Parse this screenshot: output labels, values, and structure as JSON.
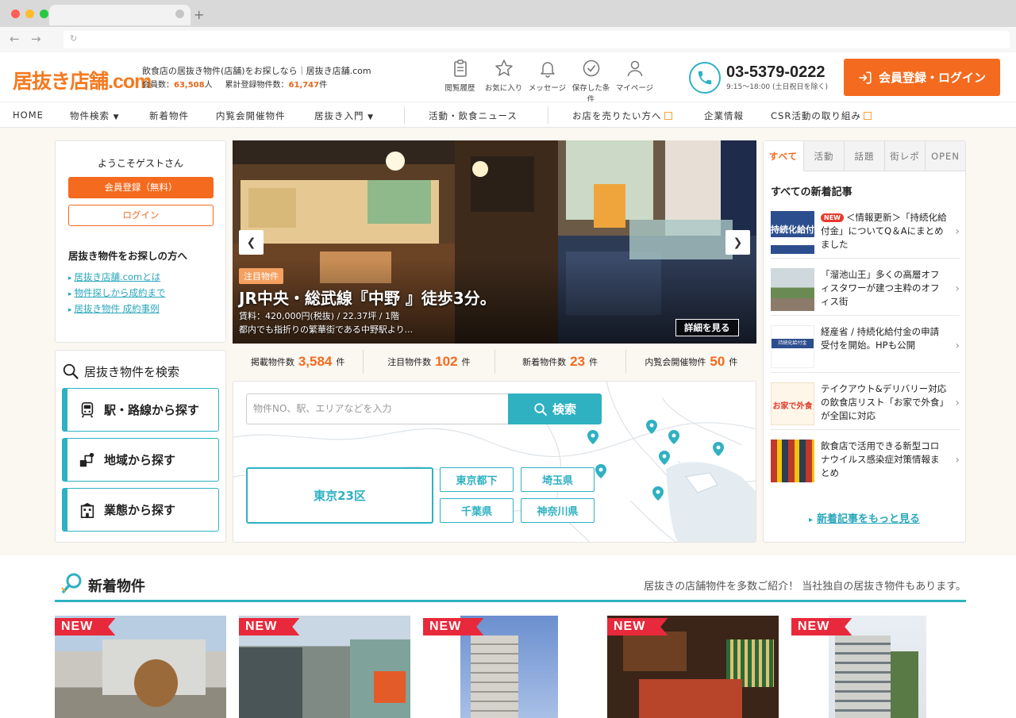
{
  "site": {
    "logo": "居抜き店舗.com",
    "tagline": "飲食店の居抜き物件(店舗)をお探しなら｜居抜き店舗.com",
    "members_label": "会員数：",
    "members_value": "63,508",
    "members_unit": "人",
    "listings_label": "累計登録物件数：",
    "listings_value": "61,747",
    "listings_unit": "件",
    "brand_color": "#f46a1e",
    "accent_color": "#2fb1c2"
  },
  "header_icons": [
    {
      "label": "閲覧履歴",
      "icon": "history-clipboard-icon"
    },
    {
      "label": "お気に入り",
      "icon": "star-icon"
    },
    {
      "label": "メッセージ",
      "icon": "bell-icon"
    },
    {
      "label": "保存した条件",
      "icon": "check-circle-icon"
    },
    {
      "label": "マイページ",
      "icon": "user-icon"
    }
  ],
  "contact": {
    "phone": "03-5379-0222",
    "hours": "9:15～18:00 (土日祝日を除く)"
  },
  "login_button": "会員登録・ログイン",
  "global_nav": {
    "home": "HOME",
    "search": "物件検索",
    "new": "新着物件",
    "viewing": "内覧会開催物件",
    "intro": "居抜き入門",
    "news": "活動・飲食ニュース",
    "sell": "お店を売りたい方へ",
    "company": "企業情報",
    "csr": "CSR活動の取り組み"
  },
  "welcome": {
    "title": "ようこそゲストさん",
    "register": "会員登録（無料）",
    "login": "ログイン",
    "subtitle": "居抜き物件をお探しの方へ",
    "links": [
      "居抜き店舗.comとは",
      "物件探しから成約まで",
      "居抜き物件 成約事例"
    ]
  },
  "search_panel": {
    "title": "居抜き物件を検索",
    "station": "駅・路線から探す",
    "area": "地域から探す",
    "business": "業態から探す"
  },
  "hero": {
    "badge": "注目物件",
    "title": "JR中央・総武線『中野 』徒歩3分。",
    "rent": "賃料：420,000円(税抜) / 22.37坪 / 1階",
    "description": "都内でも指折りの繁華街である中野駅より...",
    "detail_button": "詳細を見る"
  },
  "counts": [
    {
      "label": "掲載物件数",
      "value": "3,584",
      "unit": "件"
    },
    {
      "label": "注目物件数",
      "value": "102",
      "unit": "件"
    },
    {
      "label": "新着物件数",
      "value": "23",
      "unit": "件"
    },
    {
      "label": "内覧会開催物件",
      "value": "50",
      "unit": "件"
    }
  ],
  "map_search": {
    "placeholder": "物件NO、駅、エリアなどを入力",
    "button": "検索",
    "main_area": "東京23区",
    "areas": [
      "東京都下",
      "埼玉県",
      "千葉県",
      "神奈川県"
    ]
  },
  "news": {
    "tabs": [
      "すべて",
      "活動",
      "話題",
      "街レポ",
      "OPEN"
    ],
    "heading": "すべての新着記事",
    "items": [
      {
        "new": "NEW",
        "title": "＜情報更新＞「持続化給付金」についてQ＆Aにまとめました",
        "thumb": "持続化給付"
      },
      {
        "new": "",
        "title": "「溜池山王」多くの高層オフィスタワーが建つ主粋のオフィス街",
        "thumb": ""
      },
      {
        "new": "",
        "title": "経産省 / 持続化給付金の申請受付を開始。HPも公開",
        "thumb": "持続化給付金"
      },
      {
        "new": "",
        "title": "テイクアウト&デリバリー対応の飲食店リスト「お家で外食」が全国に対応",
        "thumb": "お家で外食"
      },
      {
        "new": "",
        "title": "飲食店で活用できる新型コロナウイルス感染症対策情報まとめ",
        "thumb": ""
      }
    ],
    "more": "新着記事をもっと見る"
  },
  "new_listings": {
    "title": "新着物件",
    "lead": "居抜きの店舗物件を多数ご紹介！ 当社独自の居抜き物件もあります。",
    "badge": "NEW"
  }
}
